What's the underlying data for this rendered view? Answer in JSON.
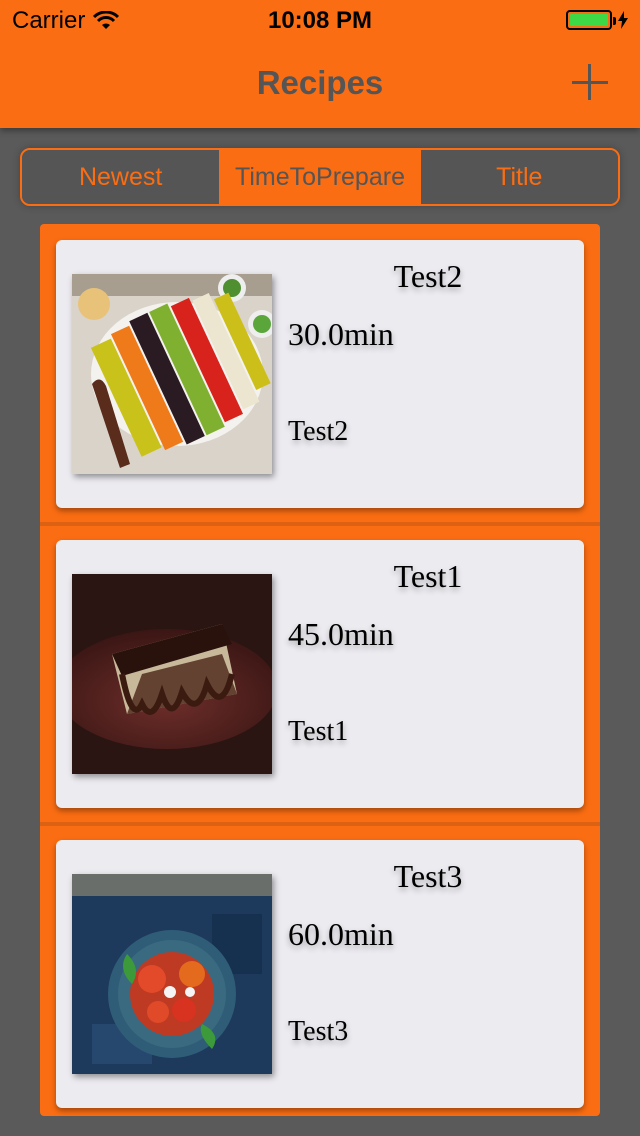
{
  "status_bar": {
    "carrier": "Carrier",
    "time": "10:08 PM"
  },
  "nav": {
    "title": "Recipes",
    "add_icon": "plus-icon"
  },
  "sort_control": {
    "options": [
      "Newest",
      "TimeToPrepare",
      "Title"
    ],
    "selected": "TimeToPrepare"
  },
  "recipes": [
    {
      "title": "Test2",
      "time": "30.0min",
      "description": "Test2",
      "image": "salad-platter-photo"
    },
    {
      "title": "Test1",
      "time": "45.0min",
      "description": "Test1",
      "image": "chocolate-cake-photo"
    },
    {
      "title": "Test3",
      "time": "60.0min",
      "description": "Test3",
      "image": "tomato-salad-bowl-photo"
    }
  ],
  "colors": {
    "accent": "#fb6d12",
    "background": "#5a5a5a",
    "card": "#ecebf0",
    "nav_text": "#555555"
  }
}
